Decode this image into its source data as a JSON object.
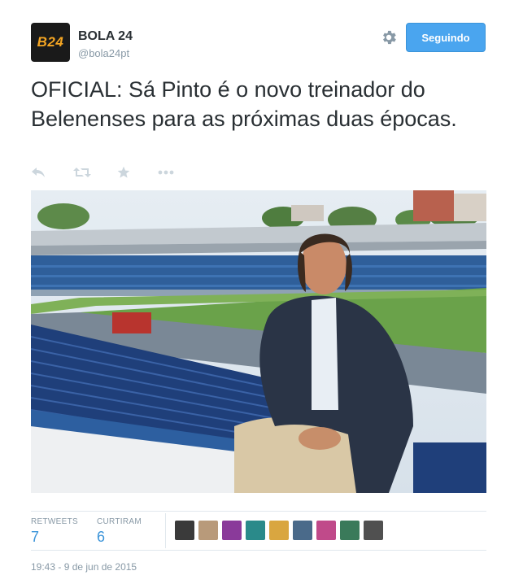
{
  "account": {
    "avatar_text": "B24",
    "name": "BOLA 24",
    "handle": "@bola24pt"
  },
  "header": {
    "settings_icon": "gear-icon",
    "follow_label": "Seguindo"
  },
  "tweet": {
    "text": "OFICIAL: Sá Pinto é o novo treinador do Belenenses para as próximas duas épocas.",
    "actions": [
      "reply-icon",
      "retweet-icon",
      "favorite-icon",
      "more-icon"
    ]
  },
  "stats": {
    "retweets_label": "RETWEETS",
    "retweets_count": "7",
    "favorites_label": "CURTIRAM",
    "favorites_count": "6"
  },
  "favoriters": [
    {
      "color": "#3a3a3a"
    },
    {
      "color": "#b89a7a"
    },
    {
      "color": "#8a3a9a"
    },
    {
      "color": "#2a8a8a"
    },
    {
      "color": "#d9a640"
    },
    {
      "color": "#4a6a8a"
    },
    {
      "color": "#c04a8a"
    },
    {
      "color": "#3a7a5a"
    },
    {
      "color": "#505050"
    }
  ],
  "footer": {
    "timestamp": "19:43 - 9 de jun de 2015"
  },
  "colors": {
    "accent": "#4aa5ef",
    "link": "#3b94d9",
    "muted": "#8899a6"
  }
}
